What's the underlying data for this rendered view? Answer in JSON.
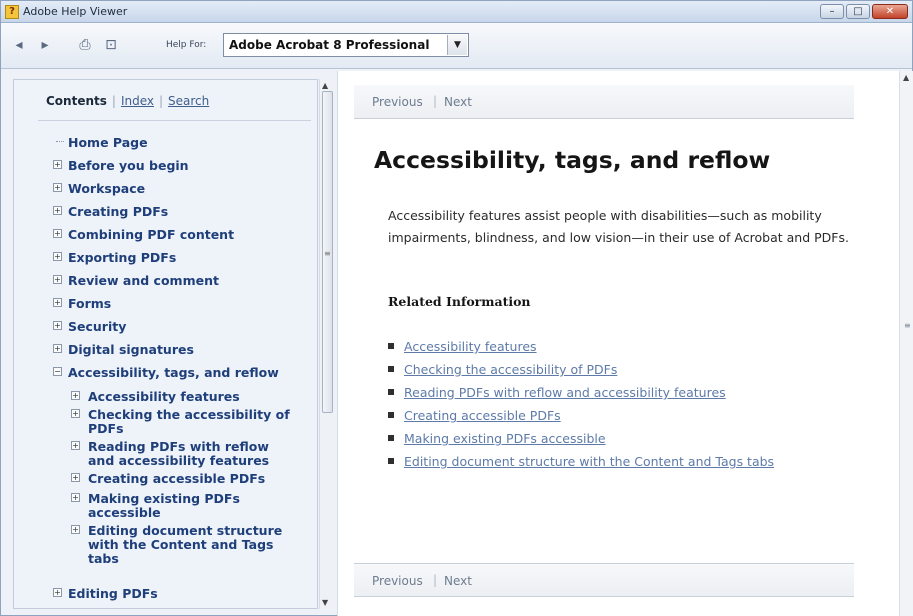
{
  "window": {
    "title": "Adobe Help Viewer",
    "app_icon_glyph": "?"
  },
  "toolbar": {
    "back_icon": "◂",
    "forward_icon": "▸",
    "print_icon": "⎙",
    "info_icon": "⊡",
    "help_for_label": "Help For:",
    "help_for_value": "Adobe Acrobat 8 Professional"
  },
  "left_pane": {
    "tabs": {
      "contents": "Contents",
      "index": "Index",
      "search": "Search",
      "sep": "|"
    },
    "toc": [
      {
        "label": "Home Page"
      },
      {
        "label": "Before you begin"
      },
      {
        "label": "Workspace"
      },
      {
        "label": "Creating PDFs"
      },
      {
        "label": "Combining PDF content"
      },
      {
        "label": "Exporting PDFs"
      },
      {
        "label": "Review and comment"
      },
      {
        "label": "Forms"
      },
      {
        "label": "Security"
      },
      {
        "label": "Digital signatures"
      },
      {
        "label": "Accessibility, tags, and reflow"
      },
      {
        "label": "Accessibility features"
      },
      {
        "label": "Checking the accessibility of",
        "label2": "PDFs"
      },
      {
        "label": "Reading PDFs with reflow",
        "label2": "and accessibility features"
      },
      {
        "label": "Creating accessible PDFs"
      },
      {
        "label": "Making existing PDFs",
        "label2": "accessible"
      },
      {
        "label": "Editing document structure",
        "label2": "with the Content and Tags",
        "label3": "tabs"
      },
      {
        "label": "Editing PDFs"
      }
    ]
  },
  "content": {
    "nav": {
      "previous": "Previous",
      "next": "Next",
      "sep": "|"
    },
    "title": "Accessibility, tags, and reflow",
    "description": "Accessibility features assist people with disabilities—such as mobility impairments, blindness, and low vision—in their use of Acrobat and PDFs.",
    "related_heading": "Related Information",
    "related_links": [
      "Accessibility features",
      "Checking the accessibility of PDFs",
      "Reading PDFs with reflow and accessibility features",
      "Creating accessible PDFs",
      "Making existing PDFs accessible",
      "Editing document structure with the Content and Tags tabs"
    ]
  }
}
